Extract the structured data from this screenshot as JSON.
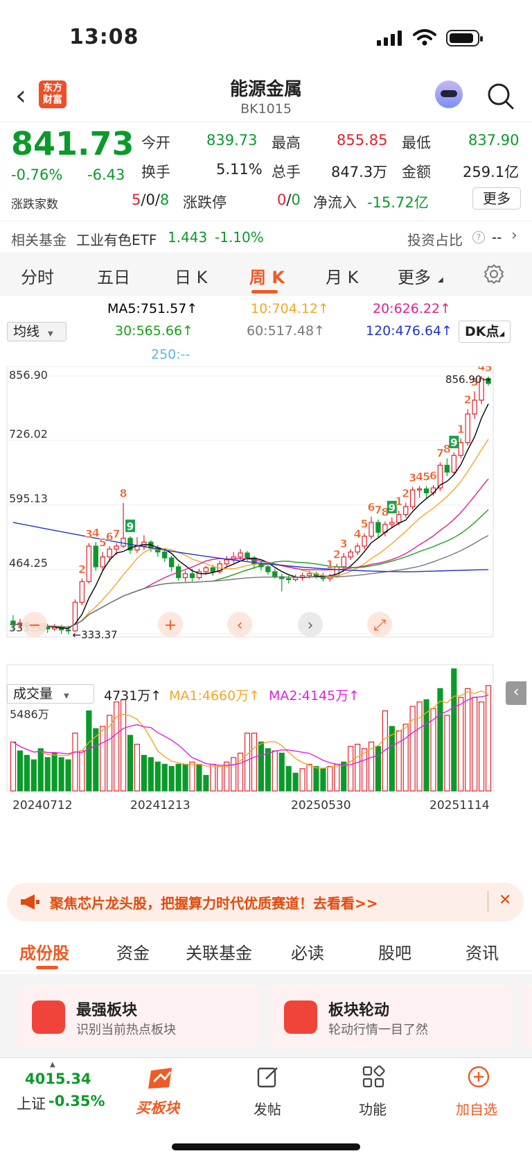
{
  "status": {
    "time": "13:08"
  },
  "nav": {
    "back_glyph": "‹",
    "logo_line1": "东方",
    "logo_line2": "财富",
    "title": "能源金属",
    "code": "BK1015"
  },
  "quote": {
    "price": "841.73",
    "pct": "-0.76%",
    "change": "-6.43",
    "open_label": "今开",
    "open": "839.73",
    "high_label": "最高",
    "high": "855.85",
    "low_label": "最低",
    "low": "837.90",
    "turnover_label": "换手",
    "turnover": "5.11%",
    "volume_label": "总手",
    "volume": "847.3万",
    "amount_label": "金额",
    "amount": "259.1亿",
    "updown_label": "涨跌家数",
    "up": "5",
    "sep1": "/",
    "flat": "0",
    "sep2": "/",
    "down": "8",
    "limit_label": "涨跌停",
    "limit_up": "0",
    "sep3": "/",
    "limit_down": "0",
    "netflow_label": "净流入",
    "netflow": "-15.72亿",
    "more_label": "更多"
  },
  "fund": {
    "label": "相关基金",
    "name": "工业有色ETF",
    "price": "1.443",
    "pct": "-1.10%",
    "ratio_label": "投资占比",
    "ratio_value": "--"
  },
  "tabs": [
    "分时",
    "五日",
    "日 K",
    "周 K",
    "月 K",
    "更多"
  ],
  "ma": {
    "selector": "均线",
    "ma5": "MA5:751.57↑",
    "ma10": "10:704.12↑",
    "ma20": "20:626.22↑",
    "ma30": "30:565.66↑",
    "ma60": "60:517.48↑",
    "ma120": "120:476.64↑",
    "ma250": "250:--",
    "dk": "DK点"
  },
  "colors": {
    "up": "#e21e2a",
    "down": "#0b9a2a",
    "ma5": "#000000",
    "ma10": "#f5a623",
    "ma20": "#e0208f",
    "ma30": "#1a9e1a",
    "ma60": "#777777",
    "ma120": "#2233cc",
    "accent": "#f15a22"
  },
  "chart_data": {
    "type": "candlestick",
    "y_ticks": [
      "856.90",
      "726.02",
      "595.13",
      "464.25",
      "333.37"
    ],
    "high_marker": "856.90→",
    "low_marker": "←333.37",
    "ylim": [
      333.37,
      856.9
    ],
    "candles": [
      [
        360,
        352,
        372,
        340
      ],
      [
        352,
        356,
        364,
        344
      ],
      [
        356,
        350,
        360,
        342
      ],
      [
        350,
        346,
        356,
        338
      ],
      [
        346,
        350,
        356,
        340
      ],
      [
        350,
        344,
        354,
        336
      ],
      [
        344,
        348,
        354,
        340
      ],
      [
        348,
        342,
        352,
        334
      ],
      [
        342,
        340,
        350,
        333.37
      ],
      [
        340,
        398,
        404,
        338
      ],
      [
        398,
        440,
        446,
        392
      ],
      [
        440,
        512,
        518,
        436
      ],
      [
        512,
        470,
        520,
        462
      ],
      [
        470,
        490,
        500,
        462
      ],
      [
        490,
        506,
        512,
        480
      ],
      [
        506,
        512,
        518,
        494
      ],
      [
        512,
        528,
        600,
        508
      ],
      [
        528,
        504,
        532,
        496
      ],
      [
        504,
        512,
        530,
        498
      ],
      [
        512,
        520,
        534,
        504
      ],
      [
        520,
        508,
        524,
        500
      ],
      [
        508,
        500,
        514,
        490
      ],
      [
        500,
        488,
        506,
        480
      ],
      [
        488,
        470,
        492,
        460
      ],
      [
        470,
        448,
        476,
        442
      ],
      [
        448,
        456,
        462,
        440
      ],
      [
        456,
        448,
        466,
        440
      ],
      [
        448,
        460,
        466,
        444
      ],
      [
        460,
        468,
        472,
        454
      ],
      [
        468,
        460,
        474,
        452
      ],
      [
        460,
        476,
        482,
        456
      ],
      [
        476,
        484,
        492,
        470
      ],
      [
        484,
        490,
        500,
        478
      ],
      [
        490,
        498,
        506,
        484
      ],
      [
        498,
        488,
        502,
        482
      ],
      [
        488,
        476,
        492,
        466
      ],
      [
        476,
        470,
        482,
        462
      ],
      [
        470,
        460,
        474,
        454
      ],
      [
        460,
        450,
        466,
        446
      ],
      [
        450,
        446,
        456,
        420
      ],
      [
        446,
        444,
        452,
        436
      ],
      [
        444,
        448,
        454,
        440
      ],
      [
        448,
        452,
        458,
        442
      ],
      [
        452,
        456,
        462,
        446
      ],
      [
        456,
        452,
        460,
        446
      ],
      [
        452,
        446,
        458,
        440
      ],
      [
        446,
        452,
        456,
        440
      ],
      [
        452,
        470,
        476,
        448
      ],
      [
        470,
        490,
        498,
        466
      ],
      [
        490,
        500,
        506,
        484
      ],
      [
        500,
        512,
        518,
        494
      ],
      [
        512,
        532,
        538,
        506
      ],
      [
        532,
        560,
        572,
        526
      ],
      [
        560,
        540,
        566,
        530
      ],
      [
        540,
        556,
        562,
        532
      ],
      [
        556,
        560,
        570,
        548
      ],
      [
        560,
        576,
        584,
        554
      ],
      [
        576,
        592,
        600,
        570
      ],
      [
        592,
        626,
        632,
        586
      ],
      [
        626,
        628,
        634,
        610
      ],
      [
        628,
        620,
        634,
        608
      ],
      [
        620,
        630,
        636,
        614
      ],
      [
        630,
        676,
        682,
        624
      ],
      [
        676,
        662,
        690,
        654
      ],
      [
        662,
        696,
        702,
        658
      ],
      [
        696,
        722,
        730,
        690
      ],
      [
        722,
        780,
        790,
        716
      ],
      [
        780,
        808,
        826,
        770
      ],
      [
        808,
        852,
        856.9,
        800
      ],
      [
        852,
        841.73,
        855.85,
        837.9
      ]
    ],
    "volume_label": "成交量",
    "volume_value": "4731万↑",
    "vol_ma1": "MA1:4660万↑",
    "vol_ma2": "MA2:4145万↑",
    "volume_max_label": "5486万",
    "volume_max": 5486,
    "volumes": [
      [
        2200,
        1
      ],
      [
        1800,
        0
      ],
      [
        1600,
        0
      ],
      [
        1400,
        0
      ],
      [
        1900,
        0
      ],
      [
        1500,
        0
      ],
      [
        1700,
        0
      ],
      [
        1500,
        0
      ],
      [
        1400,
        0
      ],
      [
        2600,
        1
      ],
      [
        1800,
        1
      ],
      [
        3600,
        0
      ],
      [
        2800,
        0
      ],
      [
        2900,
        1
      ],
      [
        3400,
        1
      ],
      [
        4000,
        1
      ],
      [
        4100,
        1
      ],
      [
        2500,
        0
      ],
      [
        2100,
        1
      ],
      [
        1600,
        0
      ],
      [
        1500,
        0
      ],
      [
        1300,
        0
      ],
      [
        1200,
        0
      ],
      [
        1100,
        0
      ],
      [
        1200,
        0
      ],
      [
        1200,
        0
      ],
      [
        1300,
        1
      ],
      [
        1200,
        0
      ],
      [
        700,
        0
      ],
      [
        1200,
        1
      ],
      [
        1100,
        1
      ],
      [
        1300,
        1
      ],
      [
        1500,
        1
      ],
      [
        1700,
        1
      ],
      [
        2600,
        1
      ],
      [
        2600,
        1
      ],
      [
        2200,
        0
      ],
      [
        1900,
        0
      ],
      [
        1800,
        1
      ],
      [
        1700,
        0
      ],
      [
        1100,
        0
      ],
      [
        800,
        0
      ],
      [
        1000,
        1
      ],
      [
        1200,
        1
      ],
      [
        1100,
        0
      ],
      [
        1000,
        0
      ],
      [
        1100,
        1
      ],
      [
        1200,
        1
      ],
      [
        1300,
        0
      ],
      [
        2000,
        1
      ],
      [
        2100,
        1
      ],
      [
        1900,
        1
      ],
      [
        2200,
        1
      ],
      [
        2000,
        0
      ],
      [
        3600,
        1
      ],
      [
        2900,
        0
      ],
      [
        2700,
        1
      ],
      [
        3000,
        1
      ],
      [
        3800,
        1
      ],
      [
        4000,
        1
      ],
      [
        4100,
        0
      ],
      [
        3700,
        1
      ],
      [
        4600,
        0
      ],
      [
        3400,
        1
      ],
      [
        5486,
        0
      ],
      [
        4200,
        1
      ],
      [
        4600,
        1
      ],
      [
        4200,
        1
      ],
      [
        4000,
        1
      ],
      [
        4731,
        1
      ]
    ],
    "x_labels": [
      "20240712",
      "20241213",
      "20250530",
      "20251114"
    ],
    "td_marks": [
      {
        "i": 10,
        "t": "2",
        "c": "r"
      },
      {
        "i": 11,
        "t": "3",
        "c": "r"
      },
      {
        "i": 12,
        "t": "4",
        "c": "r"
      },
      {
        "i": 13,
        "t": "5",
        "c": "r"
      },
      {
        "i": 14,
        "t": "6",
        "c": "r"
      },
      {
        "i": 15,
        "t": "7",
        "c": "r"
      },
      {
        "i": 16,
        "t": "8",
        "c": "r"
      },
      {
        "i": 17,
        "t": "9",
        "c": "g"
      },
      {
        "i": 46,
        "t": "1",
        "c": "r"
      },
      {
        "i": 47,
        "t": "2",
        "c": "r"
      },
      {
        "i": 48,
        "t": "3",
        "c": "r"
      },
      {
        "i": 50,
        "t": "4",
        "c": "r"
      },
      {
        "i": 51,
        "t": "5",
        "c": "r"
      },
      {
        "i": 52,
        "t": "6",
        "c": "r"
      },
      {
        "i": 53,
        "t": "7",
        "c": "r"
      },
      {
        "i": 54,
        "t": "8",
        "c": "r"
      },
      {
        "i": 55,
        "t": "9",
        "c": "g"
      },
      {
        "i": 56,
        "t": "1",
        "c": "r"
      },
      {
        "i": 57,
        "t": "2",
        "c": "r"
      },
      {
        "i": 58,
        "t": "3",
        "c": "r"
      },
      {
        "i": 59,
        "t": "4",
        "c": "r"
      },
      {
        "i": 60,
        "t": "5",
        "c": "r"
      },
      {
        "i": 61,
        "t": "6",
        "c": "r"
      },
      {
        "i": 62,
        "t": "7",
        "c": "r"
      },
      {
        "i": 63,
        "t": "8",
        "c": "r"
      },
      {
        "i": 64,
        "t": "9",
        "c": "g"
      },
      {
        "i": 65,
        "t": "1",
        "c": "r"
      },
      {
        "i": 66,
        "t": "2",
        "c": "r"
      },
      {
        "i": 67,
        "t": "3",
        "c": "r"
      },
      {
        "i": 68,
        "t": "4",
        "c": "r"
      },
      {
        "i": 69,
        "t": "5",
        "c": "r"
      }
    ]
  },
  "promo": {
    "text": "聚焦芯片龙头股，把握算力时代优质赛道！去看看>>",
    "close": "✕"
  },
  "bottom_tabs": [
    "成份股",
    "资金",
    "关联基金",
    "必读",
    "股吧",
    "资讯"
  ],
  "cards": [
    {
      "title": "最强板块",
      "sub": "识别当前热点板块"
    },
    {
      "title": "板块轮动",
      "sub": "轮动行情一目了然"
    }
  ],
  "bottombar": {
    "index_value": "4015.34",
    "index_name": "上证",
    "index_pct": "-0.35%",
    "buy": "买板块",
    "post": "发帖",
    "func": "功能",
    "add": "加自选"
  }
}
